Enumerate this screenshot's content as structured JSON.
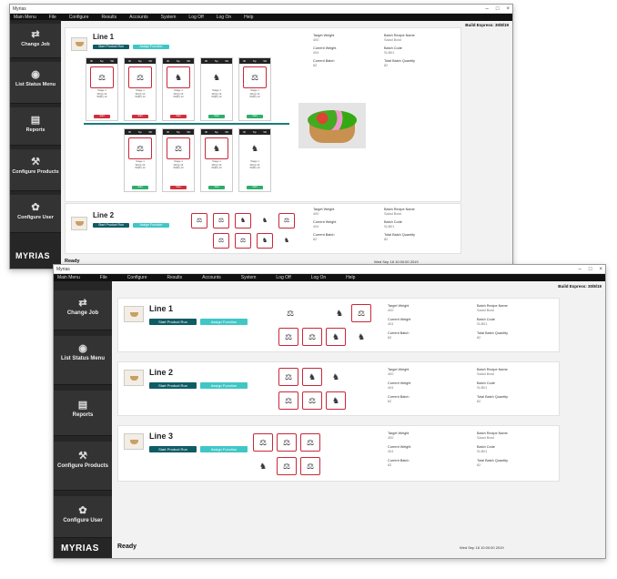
{
  "window": {
    "title": "Myrias",
    "build": "Build Express: 30/8/19"
  },
  "menu": [
    "Main Menu",
    "File",
    "Configure",
    "Results",
    "Accounts",
    "System",
    "Log Off",
    "Log On",
    "Help"
  ],
  "nav": [
    {
      "label": "Change Job",
      "icon": "swap-arrows-icon"
    },
    {
      "label": "List Status Menu",
      "icon": "list-status-icon"
    },
    {
      "label": "Reports",
      "icon": "report-icon"
    },
    {
      "label": "Configure Products",
      "icon": "wrench-icon"
    },
    {
      "label": "Configure User",
      "icon": "user-config-icon"
    }
  ],
  "brand": "MYRIAS",
  "status": "Ready",
  "datetime": "Wed Sep 18 10:00:00 2019",
  "buttons": {
    "start": "Start Product Run",
    "assign": "Assign Function"
  },
  "info_labels": {
    "target_weight": "Target Weight",
    "batch_name": "Batch Recipe Name",
    "current_weight": "Current Weight",
    "batch_code": "Batch Code",
    "current_batch": "Current Batch",
    "total_batch_qty": "Total Batch Quantity"
  },
  "info_values": {
    "target_weight": "400",
    "batch_name": "Salad Bowl",
    "current_weight": "404",
    "batch_code": "SLB01",
    "current_batch": "82",
    "total_batch_qty": "82"
  },
  "top": {
    "line1": "Line 1",
    "line2": "Line 2",
    "stand_header": [
      "ID",
      "Sp",
      "Wt"
    ],
    "stand_lines": [
      "Stage 1",
      "Wt(g) 13",
      "Wt(lb) 12",
      "Status"
    ],
    "stand_status": [
      "Start",
      "Start",
      "Start",
      "Start",
      "Start",
      "Start",
      "Start",
      "Start",
      "Start",
      "Start"
    ]
  },
  "bottom": {
    "lines": [
      "Line 1",
      "Line 2",
      "Line 3"
    ]
  },
  "colors": {
    "accent_dark": "#0f5c66",
    "accent_light": "#40c6c6",
    "alert_red": "#c8283a",
    "ok_green": "#2fae6a"
  }
}
